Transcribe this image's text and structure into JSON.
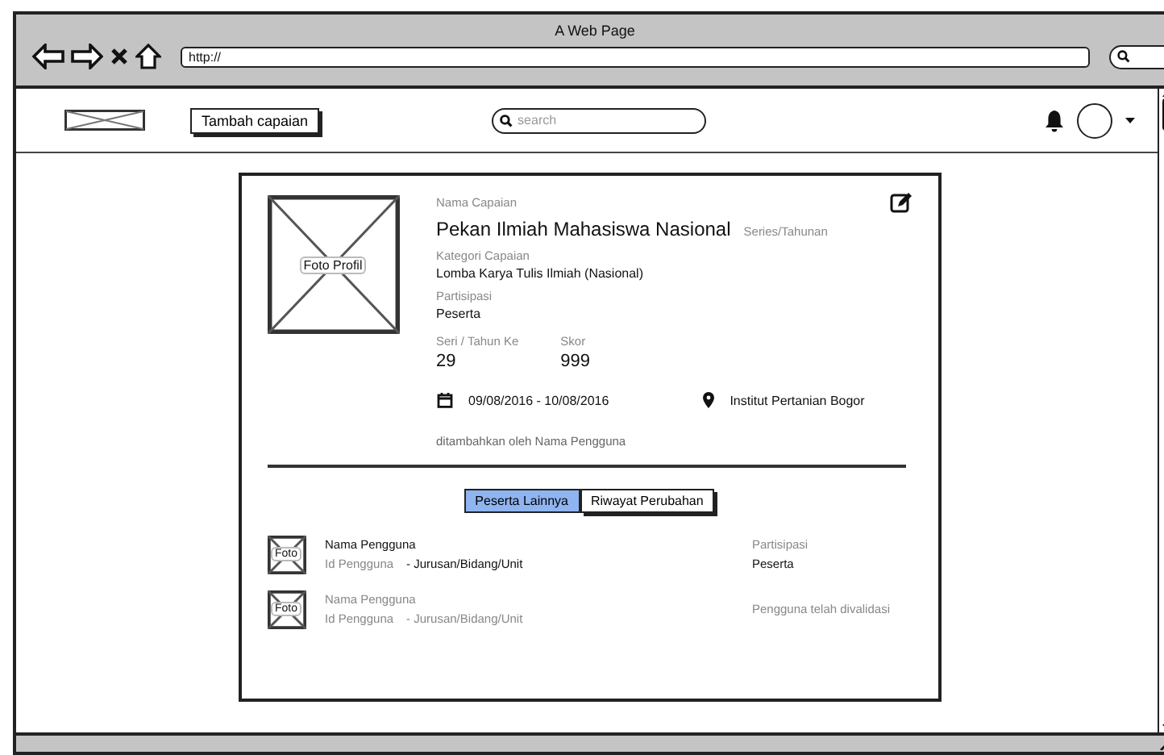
{
  "browser": {
    "title": "A Web Page",
    "url": "http://"
  },
  "header": {
    "add_button": "Tambah capaian",
    "search": {
      "placeholder": "search"
    }
  },
  "achievement": {
    "photo_label": "Foto Profil",
    "name_label": "Nama Capaian",
    "name": "Pekan Ilmiah Mahasiswa Nasional",
    "series_type": "Series/Tahunan",
    "category_label": "Kategori Capaian",
    "category": "Lomba Karya Tulis Ilmiah (Nasional)",
    "participation_label": "Partisipasi",
    "participation": "Peserta",
    "series_label": "Seri / Tahun Ke",
    "series": "29",
    "score_label": "Skor",
    "score": "999",
    "date_range": "09/08/2016 - 10/08/2016",
    "location": "Institut Pertanian Bogor",
    "added_by": "ditambahkan oleh Nama Pengguna"
  },
  "tabs": [
    {
      "label": "Peserta Lainnya",
      "selected": true
    },
    {
      "label": "Riwayat Perubahan",
      "selected": false
    }
  ],
  "participants": [
    {
      "photo_label": "Foto",
      "name": "Nama Pengguna",
      "muted": false,
      "id": "Id Pengguna",
      "unit": "- Jurusan/Bidang/Unit",
      "kind": "participation",
      "status_label": "Partisipasi",
      "status": "Peserta"
    },
    {
      "photo_label": "Foto",
      "name": "Nama Pengguna",
      "muted": true,
      "id": "Id Pengguna",
      "unit": "- Jurusan/Bidang/Unit",
      "kind": "validated",
      "status": "Pengguna telah divalidasi"
    }
  ]
}
